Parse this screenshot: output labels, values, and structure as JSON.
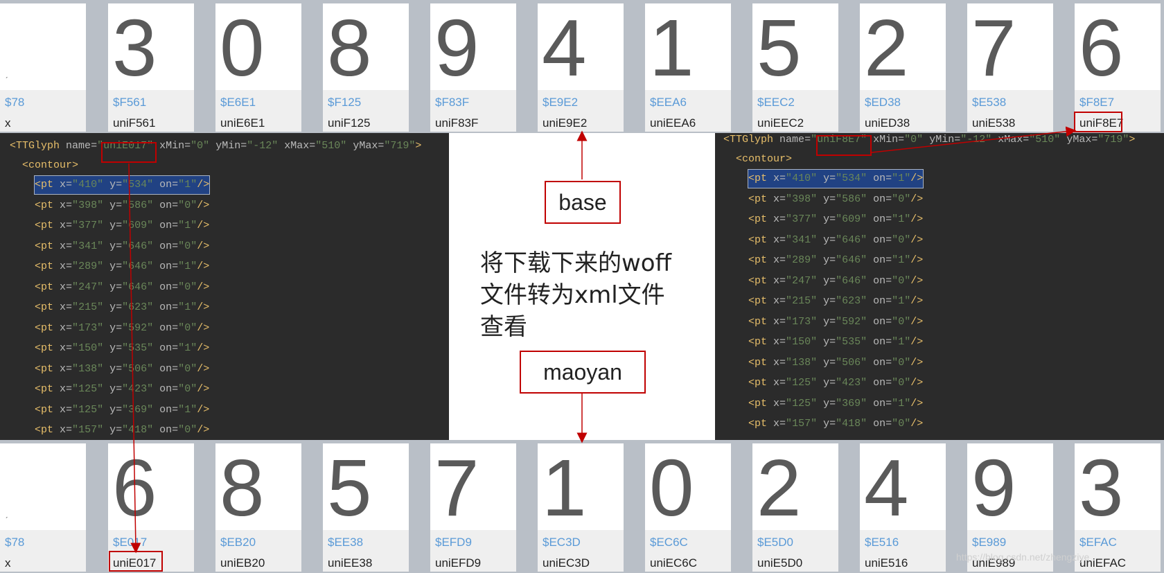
{
  "base_glyphs": [
    {
      "digit": "",
      "code": "$78",
      "name": "x"
    },
    {
      "digit": "3",
      "code": "$F561",
      "name": "uniF561"
    },
    {
      "digit": "0",
      "code": "$E6E1",
      "name": "uniE6E1"
    },
    {
      "digit": "8",
      "code": "$F125",
      "name": "uniF125"
    },
    {
      "digit": "9",
      "code": "$F83F",
      "name": "uniF83F"
    },
    {
      "digit": "4",
      "code": "$E9E2",
      "name": "uniE9E2"
    },
    {
      "digit": "1",
      "code": "$EEA6",
      "name": "uniEEA6"
    },
    {
      "digit": "5",
      "code": "$EEC2",
      "name": "uniEEC2"
    },
    {
      "digit": "2",
      "code": "$ED38",
      "name": "uniED38"
    },
    {
      "digit": "7",
      "code": "$E538",
      "name": "uniE538"
    },
    {
      "digit": "6",
      "code": "$F8E7",
      "name": "uniF8E7"
    }
  ],
  "maoyan_glyphs": [
    {
      "digit": "",
      "code": "$78",
      "name": "x"
    },
    {
      "digit": "6",
      "code": "$E017",
      "name": "uniE017"
    },
    {
      "digit": "8",
      "code": "$EB20",
      "name": "uniEB20"
    },
    {
      "digit": "5",
      "code": "$EE38",
      "name": "uniEE38"
    },
    {
      "digit": "7",
      "code": "$EFD9",
      "name": "uniEFD9"
    },
    {
      "digit": "1",
      "code": "$EC3D",
      "name": "uniEC3D"
    },
    {
      "digit": "0",
      "code": "$EC6C",
      "name": "uniEC6C"
    },
    {
      "digit": "2",
      "code": "$E5D0",
      "name": "uniE5D0"
    },
    {
      "digit": "4",
      "code": "$E516",
      "name": "uniE516"
    },
    {
      "digit": "9",
      "code": "$E989",
      "name": "uniE989"
    },
    {
      "digit": "3",
      "code": "$EFAC",
      "name": "uniEFAC"
    }
  ],
  "left_xml": {
    "glyph_name": "uniE017",
    "xMin": "0",
    "yMin": "-12",
    "xMax": "510",
    "yMax": "719",
    "points": [
      {
        "x": "410",
        "y": "534",
        "on": "1"
      },
      {
        "x": "398",
        "y": "586",
        "on": "0"
      },
      {
        "x": "377",
        "y": "609",
        "on": "1"
      },
      {
        "x": "341",
        "y": "646",
        "on": "0"
      },
      {
        "x": "289",
        "y": "646",
        "on": "1"
      },
      {
        "x": "247",
        "y": "646",
        "on": "0"
      },
      {
        "x": "215",
        "y": "623",
        "on": "1"
      },
      {
        "x": "173",
        "y": "592",
        "on": "0"
      },
      {
        "x": "150",
        "y": "535",
        "on": "1"
      },
      {
        "x": "138",
        "y": "506",
        "on": "0"
      },
      {
        "x": "125",
        "y": "423",
        "on": "0"
      },
      {
        "x": "125",
        "y": "369",
        "on": "1"
      },
      {
        "x": "157",
        "y": "418",
        "on": "0"
      }
    ]
  },
  "right_xml": {
    "glyph_name": "uniF8E7",
    "xMin": "0",
    "yMin": "-12",
    "xMax": "510",
    "yMax": "719",
    "points": [
      {
        "x": "410",
        "y": "534",
        "on": "1"
      },
      {
        "x": "398",
        "y": "586",
        "on": "0"
      },
      {
        "x": "377",
        "y": "609",
        "on": "1"
      },
      {
        "x": "341",
        "y": "646",
        "on": "0"
      },
      {
        "x": "289",
        "y": "646",
        "on": "1"
      },
      {
        "x": "247",
        "y": "646",
        "on": "0"
      },
      {
        "x": "215",
        "y": "623",
        "on": "1"
      },
      {
        "x": "173",
        "y": "592",
        "on": "0"
      },
      {
        "x": "150",
        "y": "535",
        "on": "1"
      },
      {
        "x": "138",
        "y": "506",
        "on": "0"
      },
      {
        "x": "125",
        "y": "423",
        "on": "0"
      },
      {
        "x": "125",
        "y": "369",
        "on": "1"
      },
      {
        "x": "157",
        "y": "418",
        "on": "0"
      }
    ]
  },
  "xml_tokens": {
    "ttglyph": "TTGlyph",
    "name_attr": "name",
    "contour": "contour",
    "pt": "pt"
  },
  "labels": {
    "base": "base",
    "maoyan": "maoyan",
    "description_lines": [
      "将下载下来的woff",
      "文件转为xml文件",
      "查看"
    ]
  },
  "watermark": "https://blog.csdn.net/zhengziye",
  "colors": {
    "highlight": "#c00000",
    "code_blue": "#5a9ad7",
    "editor_bg": "#2b2b2b"
  }
}
